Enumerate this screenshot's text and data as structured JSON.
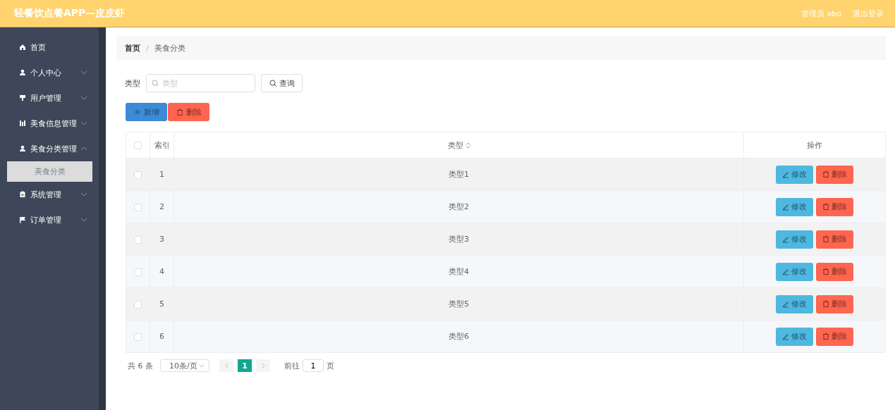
{
  "header": {
    "title": "轻餐饮点餐APP—皮皮虾",
    "user": "管理员 abo",
    "logout": "退出登录"
  },
  "sidebar": {
    "items": [
      {
        "label": "首页",
        "has_arrow": false
      },
      {
        "label": "个人中心",
        "has_arrow": true,
        "expanded": false
      },
      {
        "label": "用户管理",
        "has_arrow": true,
        "expanded": false
      },
      {
        "label": "美食信息管理",
        "has_arrow": true,
        "expanded": false
      },
      {
        "label": "美食分类管理",
        "has_arrow": true,
        "expanded": true,
        "children": [
          {
            "label": "美食分类",
            "selected": true
          }
        ]
      },
      {
        "label": "系统管理",
        "has_arrow": true,
        "expanded": false
      },
      {
        "label": "订单管理",
        "has_arrow": true,
        "expanded": false
      }
    ]
  },
  "breadcrumb": [
    "首页",
    "美食分类"
  ],
  "breadcrumb_separator": "/",
  "search": {
    "label": "类型",
    "placeholder": "类型",
    "button": "查询"
  },
  "actions": [
    {
      "label": "新增",
      "kind": "add"
    },
    {
      "label": "删除",
      "kind": "delete"
    }
  ],
  "table": {
    "select_all_checked": false,
    "columns": [
      "",
      "索引",
      "类型",
      "操作"
    ],
    "rows": [
      {
        "checked": false,
        "index": "1",
        "type": "类型1",
        "edit": "修改",
        "delete": "删除"
      },
      {
        "checked": false,
        "index": "2",
        "type": "类型2",
        "edit": "修改",
        "delete": "删除"
      },
      {
        "checked": false,
        "index": "3",
        "type": "类型3",
        "edit": "修改",
        "delete": "删除"
      },
      {
        "checked": false,
        "index": "4",
        "type": "类型4",
        "edit": "修改",
        "delete": "删除"
      },
      {
        "checked": false,
        "index": "5",
        "type": "类型5",
        "edit": "修改",
        "delete": "删除"
      },
      {
        "checked": false,
        "index": "6",
        "type": "类型6",
        "edit": "修改",
        "delete": "删除"
      }
    ]
  },
  "pagination": {
    "total": "共 6 条",
    "page_size": "10条/页",
    "pages": [
      {
        "label": "1",
        "selected": true
      }
    ],
    "goto_label": "前往",
    "goto_value": "1",
    "goto_suffix": "页"
  }
}
